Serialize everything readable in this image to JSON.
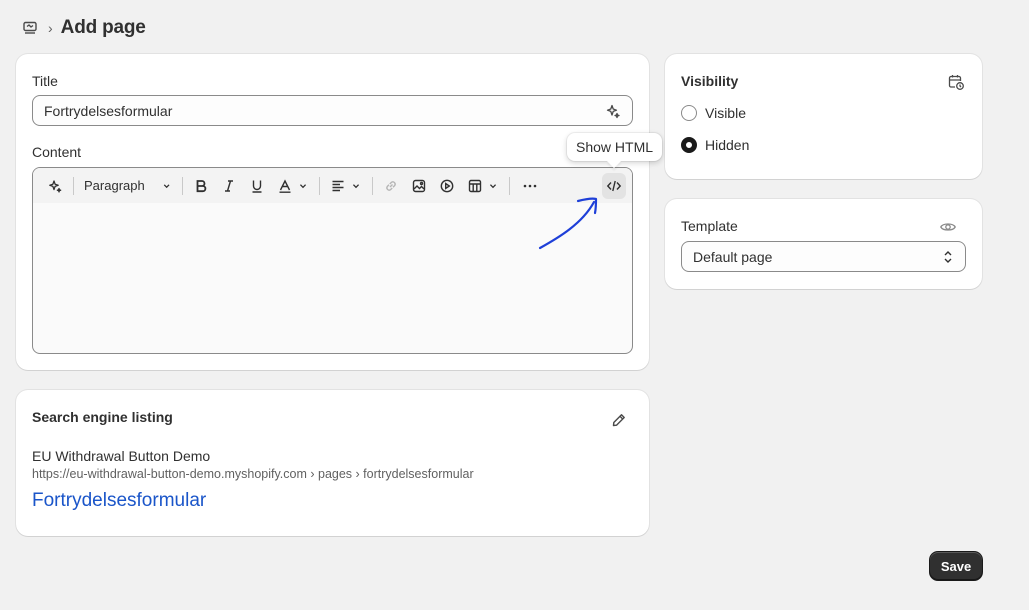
{
  "header": {
    "icon": "pages-icon",
    "separator": "›",
    "title": "Add page"
  },
  "main": {
    "title_label": "Title",
    "title_value": "Fortrydelsesformular",
    "content_label": "Content",
    "toolbar": {
      "paragraph_label": "Paragraph",
      "icons": [
        "sparkle-icon",
        "bold-icon",
        "italic-icon",
        "underline-icon",
        "text-color-icon",
        "align-icon",
        "link-icon",
        "image-icon",
        "video-icon",
        "table-icon",
        "more-icon",
        "code-icon"
      ]
    },
    "tooltip": "Show HTML",
    "annotation_color": "#1e3fd8"
  },
  "seo": {
    "title": "Search engine listing",
    "store_name": "EU Withdrawal Button Demo",
    "url": "https://eu-withdrawal-button-demo.myshopify.com › pages › fortrydelsesformular",
    "page_title": "Fortrydelsesformular",
    "link_color": "#1a55c9"
  },
  "visibility": {
    "title": "Visibility",
    "options": [
      {
        "label": "Visible",
        "checked": false
      },
      {
        "label": "Hidden",
        "checked": true
      }
    ]
  },
  "template": {
    "title": "Template",
    "selected": "Default page"
  },
  "actions": {
    "save_label": "Save"
  }
}
